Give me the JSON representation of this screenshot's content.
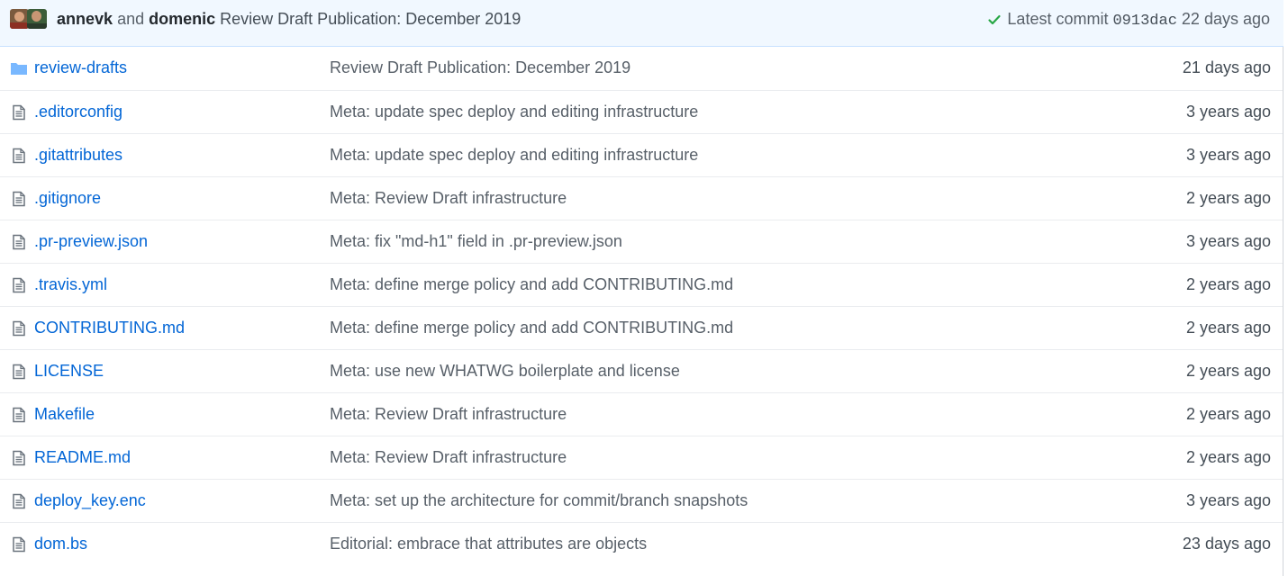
{
  "commit_bar": {
    "author1": "annevk",
    "and_word": "and",
    "author2": "domenic",
    "message": "Review Draft Publication: December 2019",
    "latest_label": "Latest commit",
    "sha": "0913dac",
    "age": "22 days ago",
    "status_color": "#28a745"
  },
  "files": [
    {
      "name": "review-drafts",
      "type": "folder",
      "message": "Review Draft Publication: December 2019",
      "age": "21 days ago"
    },
    {
      "name": ".editorconfig",
      "type": "file",
      "message": "Meta: update spec deploy and editing infrastructure",
      "age": "3 years ago"
    },
    {
      "name": ".gitattributes",
      "type": "file",
      "message": "Meta: update spec deploy and editing infrastructure",
      "age": "3 years ago"
    },
    {
      "name": ".gitignore",
      "type": "file",
      "message": "Meta: Review Draft infrastructure",
      "age": "2 years ago"
    },
    {
      "name": ".pr-preview.json",
      "type": "file",
      "message": "Meta: fix \"md-h1\" field in .pr-preview.json",
      "age": "3 years ago"
    },
    {
      "name": ".travis.yml",
      "type": "file",
      "message": "Meta: define merge policy and add CONTRIBUTING.md",
      "age": "2 years ago"
    },
    {
      "name": "CONTRIBUTING.md",
      "type": "file",
      "message": "Meta: define merge policy and add CONTRIBUTING.md",
      "age": "2 years ago"
    },
    {
      "name": "LICENSE",
      "type": "file",
      "message": "Meta: use new WHATWG boilerplate and license",
      "age": "2 years ago"
    },
    {
      "name": "Makefile",
      "type": "file",
      "message": "Meta: Review Draft infrastructure",
      "age": "2 years ago"
    },
    {
      "name": "README.md",
      "type": "file",
      "message": "Meta: Review Draft infrastructure",
      "age": "2 years ago"
    },
    {
      "name": "deploy_key.enc",
      "type": "file",
      "message": "Meta: set up the architecture for commit/branch snapshots",
      "age": "3 years ago"
    },
    {
      "name": "dom.bs",
      "type": "file",
      "message": "Editorial: embrace that attributes are objects",
      "age": "23 days ago"
    }
  ],
  "colors": {
    "link": "#0366d6",
    "icon": "#6a737d",
    "folder_icon": "#79b8ff"
  }
}
